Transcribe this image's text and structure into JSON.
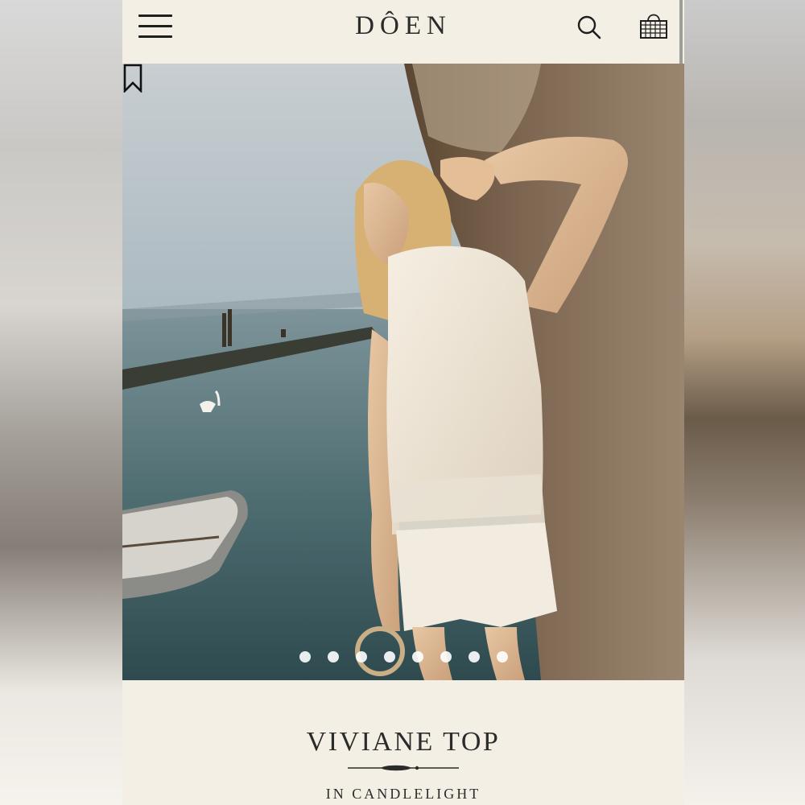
{
  "header": {
    "brand": "DÔEN",
    "icons": [
      "menu-icon",
      "search-icon",
      "basket-icon"
    ]
  },
  "gallery": {
    "icons": [
      "bookmark-icon"
    ],
    "slide_count": 8,
    "active_slide": 1
  },
  "product": {
    "title": "VIVIANE TOP",
    "color_line": "IN CANDLELIGHT"
  },
  "colors": {
    "background": "#f4f0e6",
    "text": "#2b2b2b"
  }
}
